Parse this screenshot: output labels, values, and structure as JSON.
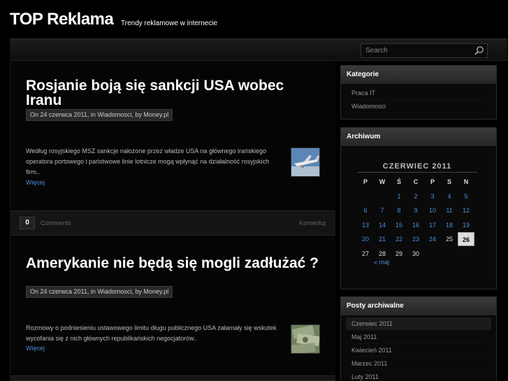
{
  "site": {
    "title": "TOP Reklama",
    "tagline": "Trendy reklamowe w internecie"
  },
  "search": {
    "placeholder": "Search"
  },
  "posts": [
    {
      "title": "Rosjanie boją się sankcji USA wobec Iranu",
      "meta": "On 24 czerwca 2011, in Wiadomosci, by Money.pl",
      "excerpt": "Według rosyjskiego MSZ sankcje nałożone przez władze USA na głównego irańskiego operatora portowego i państwowe linie lotnicze mogą wpłynąć na działalność rosyjskich firm..",
      "more": "Więcej",
      "comments_count": "0",
      "comments_label": "Comments",
      "comment_link": "Komentuj"
    },
    {
      "title": "Amerykanie nie będą się mogli zadłużać ?",
      "meta": "On 24 czerwca 2011, in Wiadomosci, by Money.pl",
      "excerpt": "Rozmowy o podniesieniu ustawowego limitu długu publicznego USA załamały się wskutek wycofania się z nich głównych republikańskich negocjatorów..",
      "more": "Więcej"
    }
  ],
  "sidebar": {
    "categories": {
      "title": "Kategorie",
      "items": [
        "Praca IT",
        "Wiadomosci"
      ]
    },
    "archive": {
      "title": "Archiwum",
      "calendar": {
        "caption": "CZERWIEC 2011",
        "weekdays": [
          "P",
          "W",
          "Ś",
          "C",
          "P",
          "S",
          "N"
        ],
        "rows": [
          [
            "",
            "",
            "1",
            "2",
            "3",
            "4",
            "5"
          ],
          [
            "6",
            "7",
            "8",
            "9",
            "10",
            "11",
            "12"
          ],
          [
            "13",
            "14",
            "15",
            "16",
            "17",
            "18",
            "19"
          ],
          [
            "20",
            "21",
            "22",
            "23",
            "24",
            "25",
            "26"
          ],
          [
            "27",
            "28",
            "29",
            "30",
            "",
            "",
            ""
          ]
        ],
        "linked_days": [
          "1",
          "2",
          "3",
          "4",
          "5",
          "6",
          "7",
          "8",
          "9",
          "10",
          "11",
          "12",
          "13",
          "14",
          "15",
          "16",
          "17",
          "18",
          "19",
          "20",
          "21",
          "22",
          "23",
          "24"
        ],
        "today": "26",
        "prev": "« maj"
      }
    },
    "posted_archive": {
      "title": "Posty archiwalne",
      "items": [
        "Czerwiec 2011",
        "Maj 2011",
        "Kwiecień 2011",
        "Marzec 2011",
        "Luty 2011"
      ]
    }
  },
  "colors": {
    "link": "#4d8fd6",
    "background": "#000000",
    "widget_header": "#2e2e2e"
  },
  "icons": {
    "search": "search-icon"
  }
}
